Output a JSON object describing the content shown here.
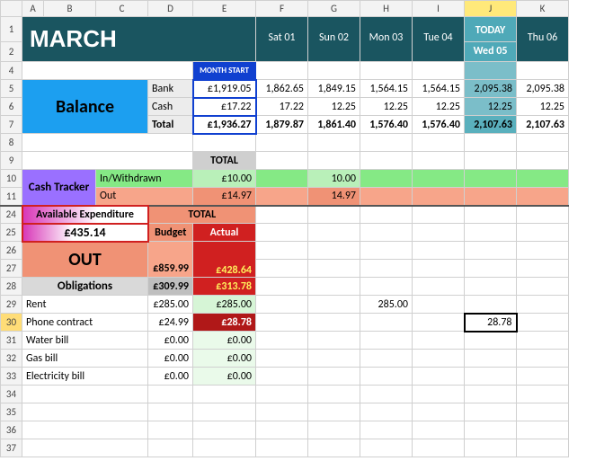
{
  "columns": [
    "A",
    "B",
    "C",
    "D",
    "E",
    "F",
    "G",
    "H",
    "I",
    "J",
    "K"
  ],
  "rows": [
    "1",
    "2",
    "4",
    "5",
    "6",
    "7",
    "8",
    "9",
    "10",
    "11",
    "24",
    "25",
    "26",
    "27",
    "28",
    "29",
    "30",
    "31",
    "32",
    "33",
    "34",
    "35",
    "36",
    "37"
  ],
  "month": "MARCH",
  "today_label": "TODAY",
  "days": [
    "Sat 01",
    "Sun 02",
    "Mon 03",
    "Tue 04",
    "Wed 05",
    "Thu 06"
  ],
  "month_start": "MONTH START",
  "balance": {
    "label": "Balance",
    "rows": [
      "Bank",
      "Cash",
      "Total"
    ],
    "start": [
      "£1,919.05",
      "£17.22",
      "£1,936.27"
    ],
    "grid": [
      [
        "1,862.65",
        "1,849.15",
        "1,564.15",
        "1,564.15",
        "2,095.38",
        "2,095.38"
      ],
      [
        "17.22",
        "12.25",
        "12.25",
        "12.25",
        "12.25",
        "12.25"
      ],
      [
        "1,879.87",
        "1,861.40",
        "1,576.40",
        "1,576.40",
        "2,107.63",
        "2,107.63"
      ]
    ]
  },
  "total_label": "TOTAL",
  "cash_tracker": {
    "label": "Cash Tracker",
    "in_label": "In/Withdrawn",
    "out_label": "Out",
    "in_total": "£10.00",
    "out_total": "£14.97",
    "in_g": "10.00",
    "out_g": "14.97"
  },
  "avail": {
    "label": "Available Expenditure",
    "amount": "£435.14"
  },
  "out_section": {
    "label": "OUT",
    "total_label": "TOTAL",
    "budget_label": "Budget",
    "actual_label": "Actual",
    "budget_total": "£859.99",
    "actual_total": "£428.64"
  },
  "obligations": {
    "label": "Obligations",
    "budget": "£309.99",
    "actual": "£313.78",
    "items": [
      {
        "name": "Rent",
        "budget": "£285.00",
        "actual": "£285.00",
        "H": "285.00",
        "J": ""
      },
      {
        "name": "Phone contract",
        "budget": "£24.99",
        "actual": "£28.78",
        "H": "",
        "J": "28.78"
      },
      {
        "name": "Water bill",
        "budget": "£0.00",
        "actual": "£0.00",
        "H": "",
        "J": ""
      },
      {
        "name": "Gas bill",
        "budget": "£0.00",
        "actual": "£0.00",
        "H": "",
        "J": ""
      },
      {
        "name": "Electricity bill",
        "budget": "£0.00",
        "actual": "£0.00",
        "H": "",
        "J": ""
      }
    ]
  }
}
